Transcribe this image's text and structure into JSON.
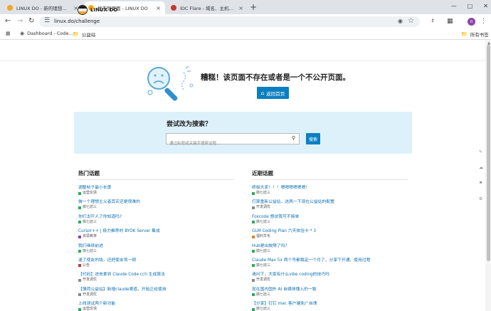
{
  "browser": {
    "tabs": [
      {
        "title": "LINUX DO - 新的理想型社区",
        "favicon_color": "#f3a71e",
        "active": false
      },
      {
        "title": "找不到页面 - LINUX DO",
        "favicon_color": "#f3a71e",
        "active": true
      },
      {
        "title": "IDC Flare - 域名、主机等信息分享",
        "favicon_color": "#c0392b",
        "active": false
      }
    ],
    "close_glyph": "×",
    "new_tab_glyph": "+",
    "url": "linux.do/challenge",
    "profile_initial": "n",
    "bookmarks": [
      {
        "label": "Dashboard - Code..."
      },
      {
        "label": "公益站"
      }
    ],
    "all_bookmarks": "所有书签"
  },
  "site": {
    "name": "LINUX DO"
  },
  "error": {
    "title": "糟糕！该页面不存在或者是一个不公开页面。",
    "home_button": "返回首页"
  },
  "search": {
    "title": "尝试改为搜索？",
    "placeholder": "通过标题或关键字搜索话题...",
    "button": "搜索"
  },
  "hot_topics": {
    "heading": "热门话题",
    "items": [
      {
        "title": "调整帖子最小长度",
        "category": "运营反馈",
        "color": "#27ae60"
      },
      {
        "title": "做一个理想主义者其实还是很难的",
        "category": "搞七捻三",
        "color": "#27ae60"
      },
      {
        "title": "你们太吓人了你知道吗?",
        "category": "搞七捻三",
        "color": "#27ae60"
      },
      {
        "title": "Cursor++ | 极力推荐的 BYOK Server 集成",
        "category": "资源荟萃",
        "color": "#8e44ad"
      },
      {
        "title": "我们继续前进",
        "category": "搞七捻三",
        "color": "#27ae60"
      },
      {
        "title": "谨了使友的钱，还把使友骂一顿",
        "category": "公告",
        "color": "#c0392b"
      },
      {
        "title": "【代码】进击拿到 Claude Code cch 生成算法",
        "category": "开发调优",
        "color": "#7f8c8d"
      },
      {
        "title": "【薄荷公益站】新增claude渠道，开始正经使用",
        "category": "开发调优",
        "color": "#7f8c8d"
      },
      {
        "title": "上线测试两个新功能",
        "category": "运营反馈",
        "color": "#27ae60"
      }
    ]
  },
  "recent_topics": {
    "heading": "近期话题",
    "items": [
      {
        "title": "终极大奖！！！嗯嗯嗯嗯嗯嗯！",
        "category": "搞七捻三",
        "color": "#27ae60"
      },
      {
        "title": "打算重新公益站，这两一下现在公益站的配置",
        "category": "开发调优",
        "color": "#7f8c8d"
      },
      {
        "title": "Foxcode 想说我可不简单",
        "category": "搞七捻三",
        "color": "#27ae60"
      },
      {
        "title": "GLM Coding Plan 六天体验卡 * 3",
        "category": "福利羊毛",
        "color": "#e67e22"
      },
      {
        "title": "Hub是出故障了吗?",
        "category": "搞七捻三",
        "color": "#27ae60"
      },
      {
        "title": "Claude Max 5x 两个号都稳定一个月了，分享下开通、使用过程",
        "category": "搞七捻三",
        "color": "#27ae60"
      },
      {
        "title": "请问下，大家有什么vibe coding的技巧吗",
        "category": "开发调优",
        "color": "#7f8c8d"
      },
      {
        "title": "现在国内国外 AI 自媒体懂入的一致",
        "category": "搞七捻三",
        "color": "#27ae60"
      },
      {
        "title": "【分享】钉钉 mac 客户端免广自律",
        "category": "搞七捻三",
        "color": "#27ae60"
      }
    ]
  }
}
